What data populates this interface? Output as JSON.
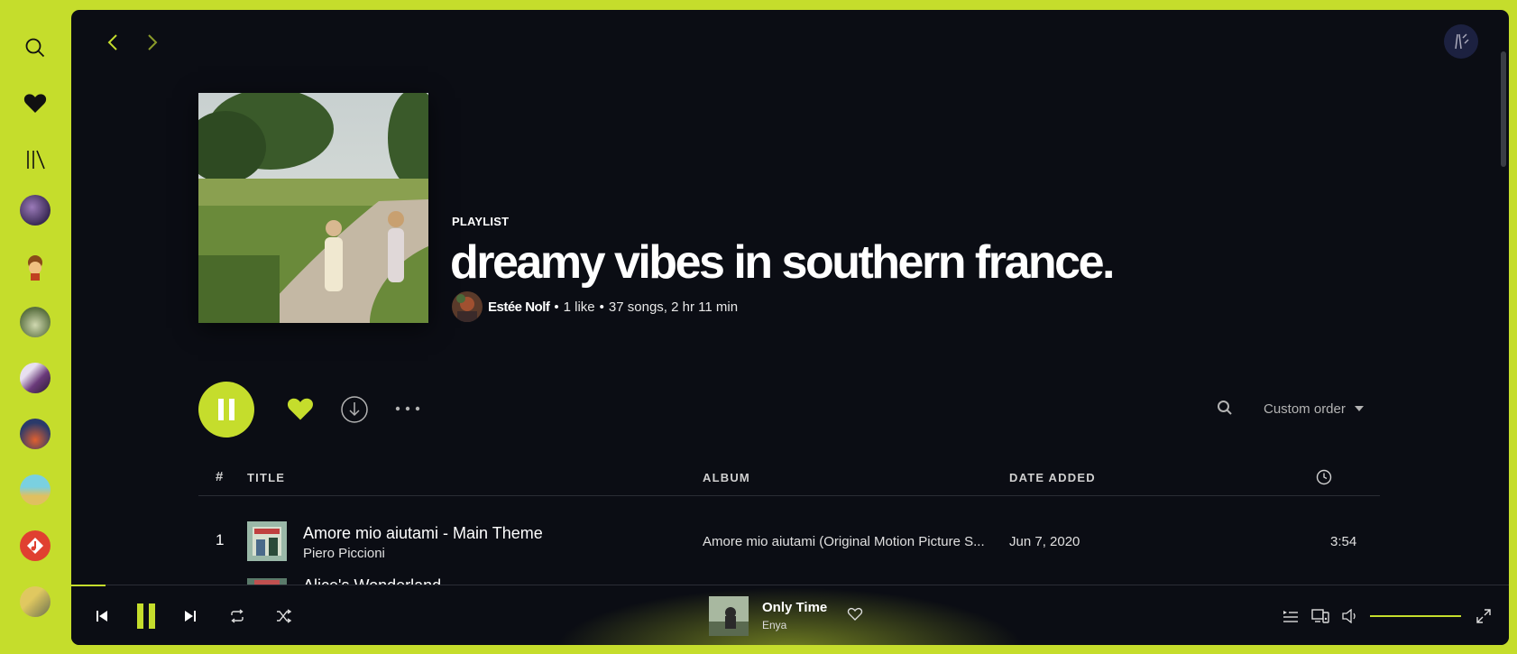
{
  "sidebar": {
    "items": [
      {
        "name": "search-icon"
      },
      {
        "name": "heart-icon"
      },
      {
        "name": "library-icon"
      }
    ],
    "playlist_avatars": 8
  },
  "nav": {
    "back": "chevron-left-icon",
    "forward": "chevron-right-icon"
  },
  "playlist": {
    "type": "PLAYLIST",
    "title": "dreamy vibes in southern france.",
    "owner": "Estée Nolf",
    "likes": "1 like",
    "summary": "37 songs, 2 hr 11 min"
  },
  "actions": {
    "sort_label": "Custom order"
  },
  "table": {
    "headers": {
      "num": "#",
      "title": "TITLE",
      "album": "ALBUM",
      "date": "DATE ADDED"
    },
    "rows": [
      {
        "num": "1",
        "title": "Amore mio aiutami - Main Theme",
        "artist": "Piero Piccioni",
        "album": "Amore mio aiutami (Original Motion Picture S...",
        "date": "Jun 7, 2020",
        "duration": "3:54"
      },
      {
        "title": "Alice's Wonderland"
      }
    ]
  },
  "player": {
    "now_playing_title": "Only Time",
    "now_playing_artist": "Enya",
    "volume": 1.0
  },
  "colors": {
    "accent": "#c5dd2c",
    "background": "#0b0d14"
  }
}
